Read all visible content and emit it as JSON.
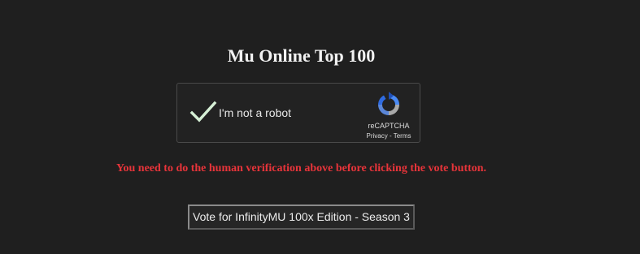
{
  "page": {
    "title": "Mu Online Top 100",
    "background_color": "#1f1f1f"
  },
  "captcha": {
    "label": "I'm not a robot",
    "checked": true,
    "brand": "reCAPTCHA",
    "privacy_link": "Privacy",
    "separator": " - ",
    "terms_link": "Terms",
    "icon": "recaptcha-logo-icon"
  },
  "notice": {
    "text": "You need to do the human verification above before clicking the vote button.",
    "color": "#e8343a"
  },
  "vote": {
    "label": "Vote for InfinityMU 100x Edition - Season 3"
  }
}
